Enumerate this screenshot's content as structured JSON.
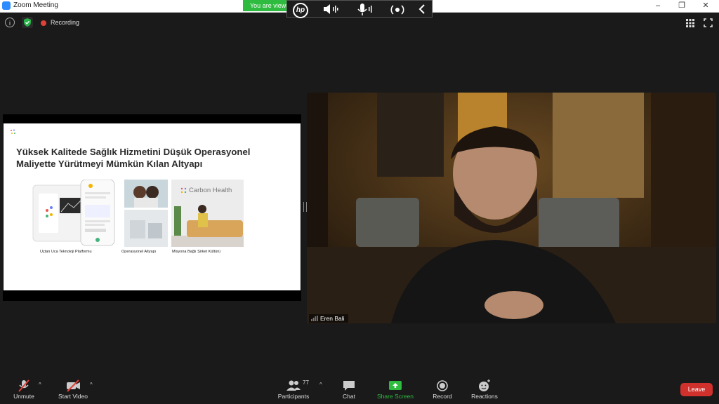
{
  "window": {
    "title": "Zoom Meeting",
    "minimize": "–",
    "restore": "❐",
    "close": "✕"
  },
  "banner": {
    "text": "You are viewing"
  },
  "hp_bar": {
    "logo": "hp"
  },
  "meeting_info": {
    "info_glyph": "i",
    "recording_label": "Recording"
  },
  "slide": {
    "heading_line1": "Yüksek Kalitede Sağlık Hizmetini Düşük Operasyonel",
    "heading_line2": "Maliyette Yürütmeyi Mümkün Kılan Altyapı",
    "brand_text": "Carbon Health",
    "captions": [
      "Uçtan Uca Teknoloji Platformu",
      "Operasyonel Altyapı",
      "Misyona Bağlı Şirket Kültürü"
    ]
  },
  "video": {
    "participant_name": "Eren Bali"
  },
  "toolbar": {
    "unmute": "Unmute",
    "start_video": "Start Video",
    "participants": "Participants",
    "participant_count": "77",
    "chat": "Chat",
    "share_screen": "Share Screen",
    "record": "Record",
    "reactions": "Reactions",
    "leave": "Leave",
    "caret": "^"
  },
  "colors": {
    "share_green": "#2fbb3f",
    "leave_red": "#d0312d",
    "recording_red": "#e0403a"
  },
  "icons": [
    "zoom-app-icon",
    "hp-logo-icon",
    "speaker-icon",
    "mic-icon",
    "broadcast-icon",
    "chevron-left-icon",
    "info-icon",
    "shield-check-icon",
    "grid-view-icon",
    "fullscreen-icon",
    "signal-bars-icon",
    "mic-muted-icon",
    "video-off-icon",
    "participants-icon",
    "chat-icon",
    "share-screen-icon",
    "record-icon",
    "reactions-icon"
  ]
}
